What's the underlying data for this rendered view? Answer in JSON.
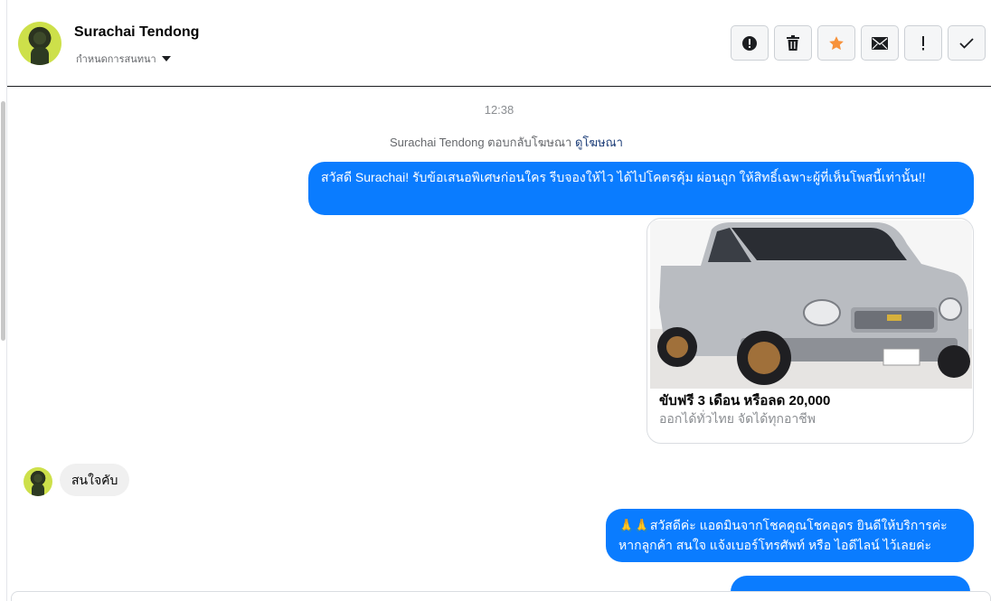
{
  "contact": {
    "name": "Surachai Tendong",
    "conversation_settings_label": "กำหนดการสนทนา"
  },
  "toolbar": {
    "actions": [
      {
        "name": "spam-alert",
        "icon": "alert-circle-icon"
      },
      {
        "name": "delete",
        "icon": "trash-icon"
      },
      {
        "name": "star",
        "icon": "star-icon",
        "color": "#f7923b"
      },
      {
        "name": "mark-unread",
        "icon": "envelope-icon"
      },
      {
        "name": "important",
        "icon": "exclamation-icon"
      },
      {
        "name": "done",
        "icon": "checkmark-icon"
      }
    ]
  },
  "thread": {
    "timestamp": "12:38",
    "ad_reply_text": "Surachai Tendong ตอบกลับโฆษณา",
    "ad_reply_link": "ดูโฆษณา",
    "messages": {
      "outgoing_1": "สวัสดี Surachai! รับข้อเสนอพิเศษก่อนใคร รีบจองให้ไว ได้ไปโคตรคุ้ม ผ่อนถูก ให้สิทธิ์เฉพาะผู้ที่เห็นโพสนี้เท่านั้น!!",
      "card_title": "ขับฟรี 3 เดือน หรือลด 20,000",
      "card_subtitle": "ออกได้ทั่วไทย จัดได้ทุกอาชีพ",
      "incoming_1": "สนใจคับ",
      "outgoing_2": "🙏🙏สวัสดีค่ะ แอดมินจากโชคคูณโชคอุดร ยินดีให้บริการค่ะ หากลูกค้า สนใจ แจ้งเบอร์โทรศัพท์ หรือ ไอดีไลน์  ไว้เลยค่ะ"
    }
  },
  "colors": {
    "outgoing_bubble": "#0a7cff",
    "incoming_bubble": "#f0f0f0",
    "star_accent": "#f7923b"
  }
}
